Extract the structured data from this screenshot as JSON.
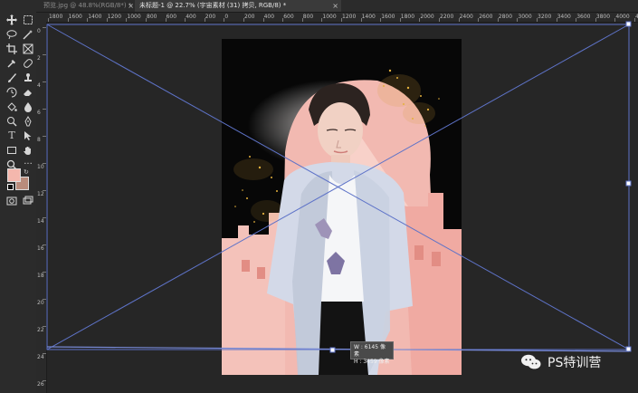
{
  "tabs": [
    {
      "label": "预览.jpg @ 48.8%(RGB/8*) *",
      "close_label": "×"
    },
    {
      "label": "未标题-1 @ 22.7% (宇宙素材 (31) 拷贝, RGB/8) *",
      "close_label": "×"
    }
  ],
  "ruler_h": [
    "1800",
    "1600",
    "1400",
    "1200",
    "1000",
    "800",
    "600",
    "400",
    "200",
    "0",
    "200",
    "400",
    "600",
    "800",
    "1000",
    "1200",
    "1400",
    "1600",
    "1800",
    "2000",
    "2200",
    "2400",
    "2600",
    "2800",
    "3000",
    "3200",
    "3400",
    "3600",
    "3800",
    "4000",
    "42"
  ],
  "ruler_v": [
    "0",
    "2",
    "4",
    "6",
    "8",
    "10",
    "12",
    "14",
    "16",
    "18",
    "20",
    "22",
    "24",
    "26"
  ],
  "transform_tip": {
    "width": "W : 6145 像素",
    "height": "H : 3459 像素"
  },
  "watermark": {
    "text": "PS特训营"
  },
  "colors": {
    "foreground": "#f4b7ad",
    "background": "#b98c7c",
    "guide": "#5e73c8"
  },
  "tools": [
    "move-icon",
    "marquee-icon",
    "lasso-icon",
    "magic-wand-icon",
    "crop-icon",
    "frame-icon",
    "eyedropper-icon",
    "healing-icon",
    "brush-icon",
    "stamp-icon",
    "history-brush-icon",
    "eraser-icon",
    "paint-bucket-icon",
    "blur-icon",
    "dodge-icon",
    "pen-icon",
    "type-icon",
    "path-select-icon",
    "rectangle-icon",
    "hand-icon",
    "zoom-icon",
    "more-icon",
    "quick-mask-icon",
    "screen-mode-icon"
  ]
}
